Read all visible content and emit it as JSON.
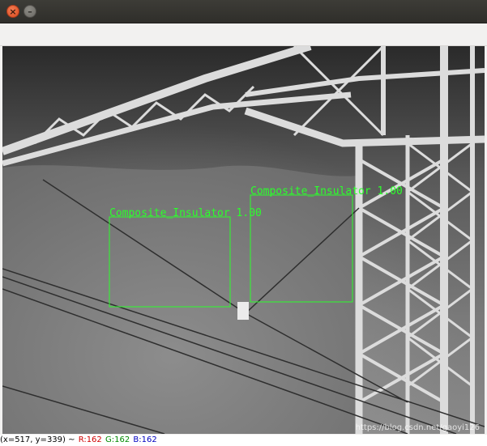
{
  "window": {
    "close_icon": "close-icon",
    "minimize_icon": "minimize-icon",
    "close_glyph": "×",
    "minimize_glyph": "–"
  },
  "detections": [
    {
      "label": "Composite_Insulator",
      "score": "1.00"
    },
    {
      "label": "Composite_Insulator",
      "score": "1.00"
    }
  ],
  "status": {
    "coords": "(x=517, y=339) ~",
    "r_label": "R:162",
    "g_label": "G:162",
    "b_label": "B:162"
  },
  "watermark": "https://blog.csdn.net/gaoyi126",
  "colors": {
    "box": "#2bff2b",
    "status_r": "#d00000",
    "status_g": "#008a00",
    "status_b": "#0000c0"
  }
}
